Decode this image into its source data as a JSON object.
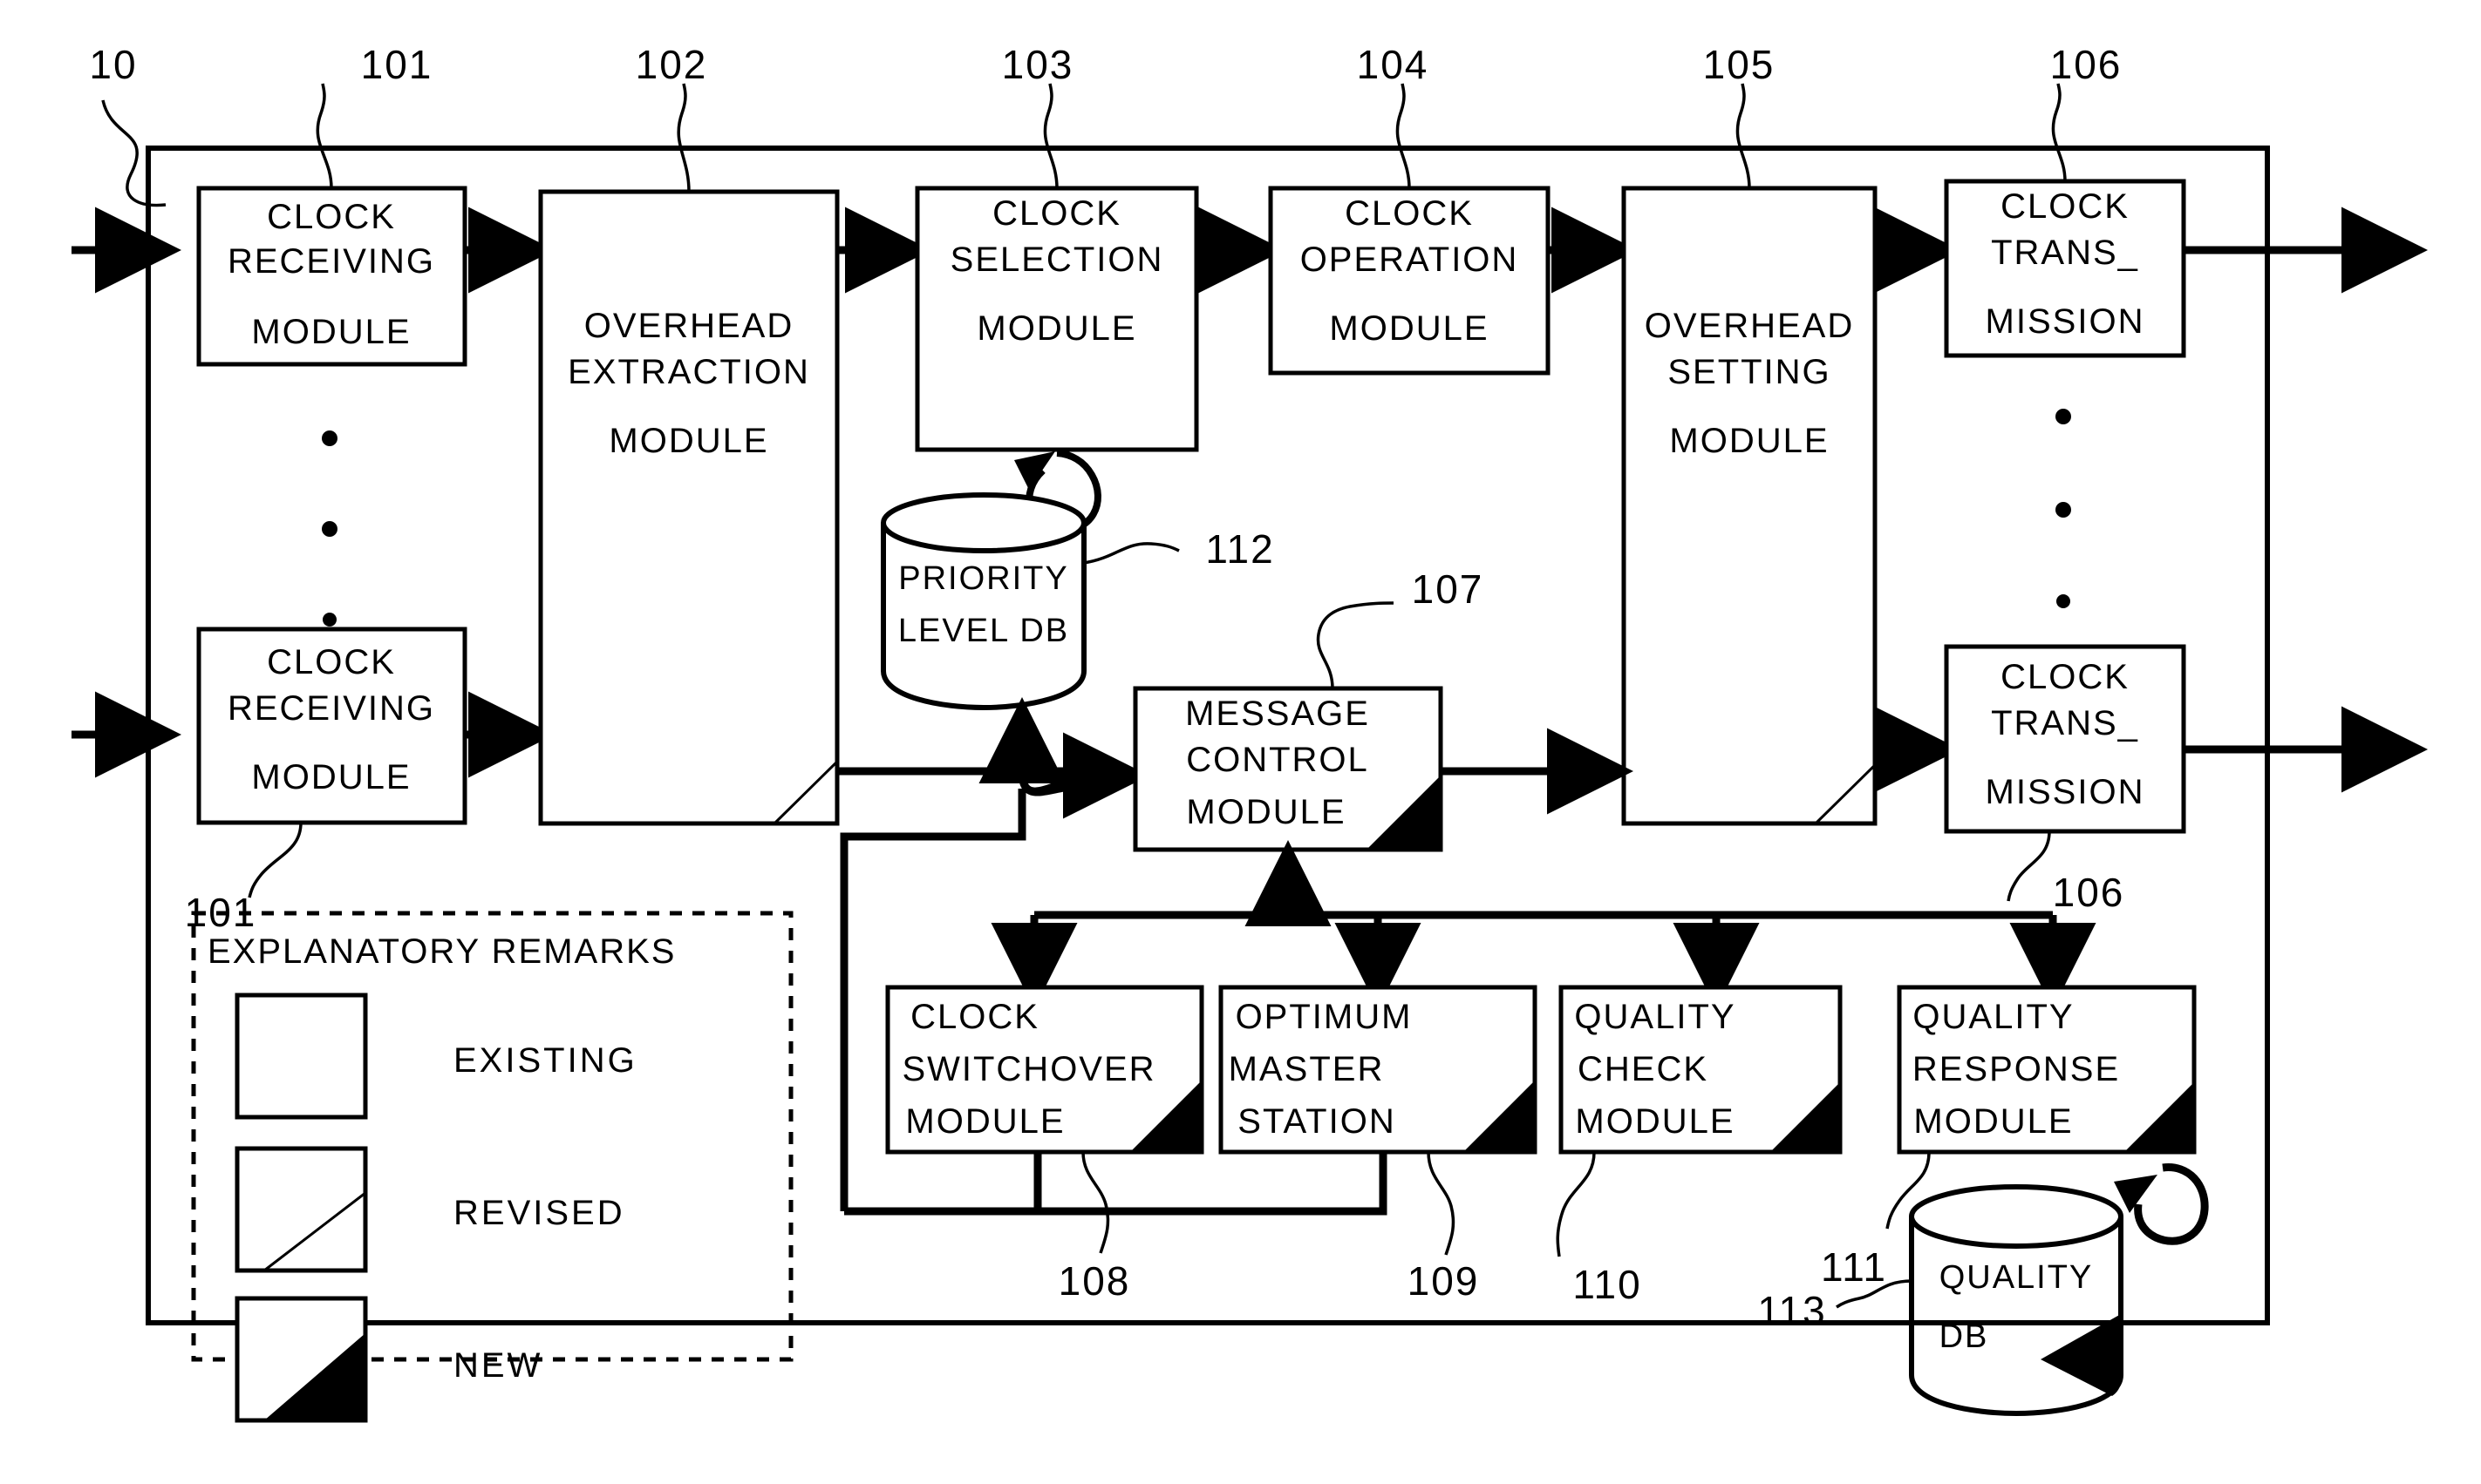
{
  "figure": {
    "type": "patent-block-diagram",
    "system_ref": "10"
  },
  "blocks": [
    {
      "id": "clock-receiving-module-top",
      "ref": "101",
      "lines": [
        "CLOCK",
        "RECEIVING",
        "MODULE"
      ],
      "marker": "existing"
    },
    {
      "id": "clock-receiving-module-bottom",
      "ref": "101",
      "lines": [
        "CLOCK",
        "RECEIVING",
        "MODULE"
      ],
      "marker": "existing"
    },
    {
      "id": "overhead-extraction-module",
      "ref": "102",
      "lines": [
        "OVERHEAD",
        "EXTRACTION",
        "MODULE"
      ],
      "marker": "revised"
    },
    {
      "id": "clock-selection-module",
      "ref": "103",
      "lines": [
        "CLOCK",
        "SELECTION",
        "MODULE"
      ],
      "marker": "existing"
    },
    {
      "id": "clock-operation-module",
      "ref": "104",
      "lines": [
        "CLOCK",
        "OPERATION",
        "MODULE"
      ],
      "marker": "existing"
    },
    {
      "id": "overhead-setting-module",
      "ref": "105",
      "lines": [
        "OVERHEAD",
        "SETTING",
        "MODULE"
      ],
      "marker": "revised"
    },
    {
      "id": "clock-transmission-top",
      "ref": "106",
      "lines": [
        "CLOCK",
        "TRANS_",
        "MISSION"
      ],
      "marker": "existing"
    },
    {
      "id": "clock-transmission-bottom",
      "ref": "106",
      "lines": [
        "CLOCK",
        "TRANS_",
        "MISSION"
      ],
      "marker": "existing"
    },
    {
      "id": "message-control-module",
      "ref": "107",
      "lines": [
        "MESSAGE",
        "CONTROL",
        "MODULE"
      ],
      "marker": "new"
    },
    {
      "id": "clock-switchover-module",
      "ref": "108",
      "lines": [
        "CLOCK",
        "SWITCHOVER",
        "MODULE"
      ],
      "marker": "new"
    },
    {
      "id": "optimum-master-station",
      "ref": "109",
      "lines": [
        "OPTIMUM",
        "MASTER",
        "STATION"
      ],
      "marker": "new"
    },
    {
      "id": "quality-check-module",
      "ref": "110",
      "lines": [
        "QUALITY",
        "CHECK",
        "MODULE"
      ],
      "marker": "new"
    },
    {
      "id": "quality-response-module",
      "ref": "111",
      "lines": [
        "QUALITY",
        "RESPONSE",
        "MODULE"
      ],
      "marker": "new"
    }
  ],
  "databases": [
    {
      "id": "priority-level-db",
      "ref": "112",
      "lines": [
        "PRIORITY",
        "LEVEL DB"
      ],
      "marker": "existing"
    },
    {
      "id": "quality-db",
      "ref": "113",
      "lines": [
        "QUALITY",
        "DB"
      ],
      "marker": "new"
    }
  ],
  "legend": {
    "title": "EXPLANATORY REMARKS",
    "items": [
      {
        "label": "EXISTING",
        "marker": "existing"
      },
      {
        "label": "REVISED",
        "marker": "revised"
      },
      {
        "label": "NEW",
        "marker": "new"
      }
    ]
  },
  "ref_numbers": {
    "system": "10",
    "r101": "101",
    "r102": "102",
    "r103": "103",
    "r104": "104",
    "r105": "105",
    "r106": "106",
    "r107": "107",
    "r108": "108",
    "r109": "109",
    "r110": "110",
    "r111": "111",
    "r112": "112",
    "r113": "113",
    "r101b": "101",
    "r106b": "106"
  },
  "text": {
    "b1l1": "CLOCK",
    "b1l2": "RECEIVING",
    "b1l3": "MODULE",
    "b2l1": "CLOCK",
    "b2l2": "RECEIVING",
    "b2l3": "MODULE",
    "b3l1": "OVERHEAD",
    "b3l2": "EXTRACTION",
    "b3l3": "MODULE",
    "b4l1": "CLOCK",
    "b4l2": "SELECTION",
    "b4l3": "MODULE",
    "b5l1": "CLOCK",
    "b5l2": "OPERATION",
    "b5l3": "MODULE",
    "b6l1": "OVERHEAD",
    "b6l2": "SETTING",
    "b6l3": "MODULE",
    "b7l1": "CLOCK",
    "b7l2": "TRANS_",
    "b7l3": "MISSION",
    "b8l1": "CLOCK",
    "b8l2": "TRANS_",
    "b8l3": "MISSION",
    "b9l1": "MESSAGE",
    "b9l2": "CONTROL",
    "b9l3": "MODULE",
    "b10l1": "CLOCK",
    "b10l2": "SWITCHOVER",
    "b10l3": "MODULE",
    "b11l1": "OPTIMUM",
    "b11l2": "MASTER",
    "b11l3": "STATION",
    "b12l1": "QUALITY",
    "b12l2": "CHECK",
    "b12l3": "MODULE",
    "b13l1": "QUALITY",
    "b13l2": "RESPONSE",
    "b13l3": "MODULE",
    "db1l1": "PRIORITY",
    "db1l2": "LEVEL DB",
    "db2l1": "QUALITY",
    "db2l2": "DB",
    "legendTitle": "EXPLANATORY REMARKS",
    "legend1": "EXISTING",
    "legend2": "REVISED",
    "legend3": "NEW"
  }
}
